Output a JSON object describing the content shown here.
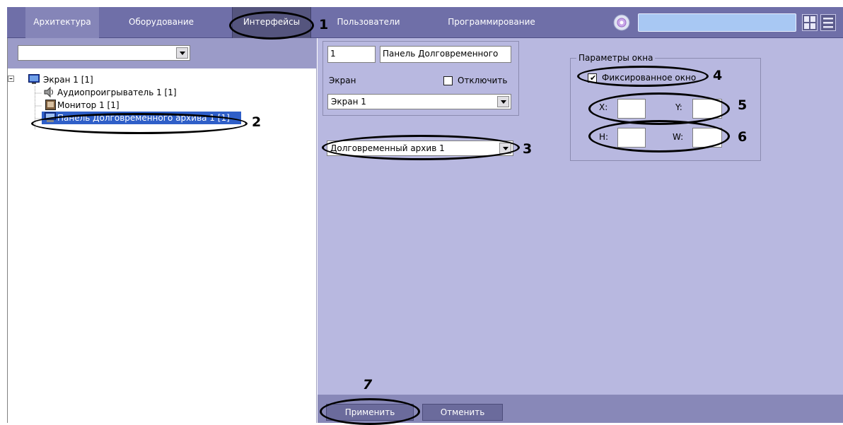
{
  "nav": {
    "tabs": [
      {
        "label": "Архитектура"
      },
      {
        "label": "Оборудование"
      },
      {
        "label": "Интерфейсы"
      },
      {
        "label": "Пользователи"
      },
      {
        "label": "Программирование"
      }
    ]
  },
  "left": {
    "filter_value": "",
    "tree": [
      {
        "label": "Экран 1 [1]",
        "icon": "screen-icon"
      },
      {
        "label": "Аудиопроигрыватель 1 [1]",
        "icon": "speaker-icon"
      },
      {
        "label": "Монитор 1 [1]",
        "icon": "monitor-icon"
      },
      {
        "label": "Панель Долговременного архива 1 [1]",
        "icon": "archive-panel-icon"
      }
    ]
  },
  "object": {
    "id_value": "1",
    "name_value": "Панель Долговременного",
    "screen_label": "Экран",
    "disable_label": "Отключить",
    "screen_value": "Экран 1",
    "archive_value": "Долговременный архив 1"
  },
  "window_params": {
    "title": "Параметры окна",
    "fixed_label": "Фиксированное окно",
    "fixed_checked": true,
    "x_label": "X:",
    "y_label": "Y:",
    "h_label": "H:",
    "w_label": "W:",
    "x_value": "",
    "y_value": "",
    "h_value": "",
    "w_value": ""
  },
  "buttons": {
    "apply": "Применить",
    "cancel": "Отменить"
  },
  "callouts": [
    "1",
    "2",
    "3",
    "4",
    "5",
    "6",
    "7"
  ]
}
